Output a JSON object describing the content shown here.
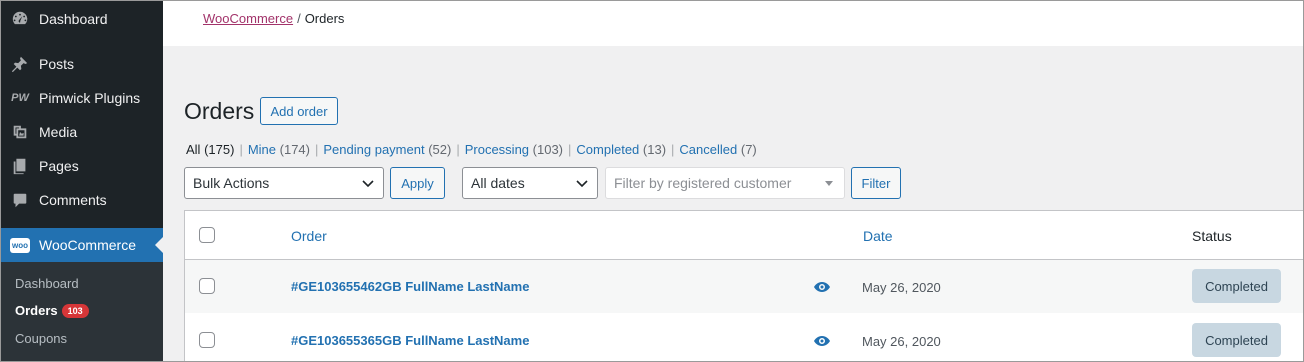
{
  "sidebar": {
    "items": [
      {
        "label": "Dashboard",
        "icon": "dashboard-icon"
      },
      {
        "label": "Posts",
        "icon": "pin-icon"
      },
      {
        "label": "Pimwick Plugins",
        "icon": "pw-logo-icon",
        "icon_text": "PW"
      },
      {
        "label": "Media",
        "icon": "media-icon"
      },
      {
        "label": "Pages",
        "icon": "pages-icon"
      },
      {
        "label": "Comments",
        "icon": "comments-icon"
      },
      {
        "label": "WooCommerce",
        "icon": "woo-icon",
        "icon_text": "woo"
      }
    ],
    "submenu": [
      {
        "label": "Dashboard"
      },
      {
        "label": "Orders",
        "badge": "103"
      },
      {
        "label": "Coupons"
      }
    ]
  },
  "breadcrumb": {
    "parent": "WooCommerce",
    "separator": "/",
    "current": "Orders"
  },
  "page": {
    "title": "Orders",
    "add_button": "Add order"
  },
  "filters": {
    "views": [
      {
        "label": "All",
        "count": "(175)"
      },
      {
        "label": "Mine",
        "count": "(174)"
      },
      {
        "label": "Pending payment",
        "count": "(52)"
      },
      {
        "label": "Processing",
        "count": "(103)"
      },
      {
        "label": "Completed",
        "count": "(13)"
      },
      {
        "label": "Cancelled",
        "count": "(7)"
      }
    ],
    "separator": "|",
    "bulk_actions": "Bulk Actions",
    "apply": "Apply",
    "dates": "All dates",
    "customer_placeholder": "Filter by registered customer",
    "filter_button": "Filter"
  },
  "table": {
    "columns": {
      "order": "Order",
      "date": "Date",
      "status": "Status"
    },
    "rows": [
      {
        "order": "#GE103655462GB FullName LastName",
        "date": "May 26, 2020",
        "status": "Completed"
      },
      {
        "order": "#GE103655365GB FullName LastName",
        "date": "May 26, 2020",
        "status": "Completed"
      }
    ]
  },
  "colors": {
    "sidebar_bg": "#1d2327",
    "accent": "#2271b1",
    "woo_link": "#a2336a",
    "badge": "#d63638",
    "status_completed_bg": "#c8d7e1"
  }
}
